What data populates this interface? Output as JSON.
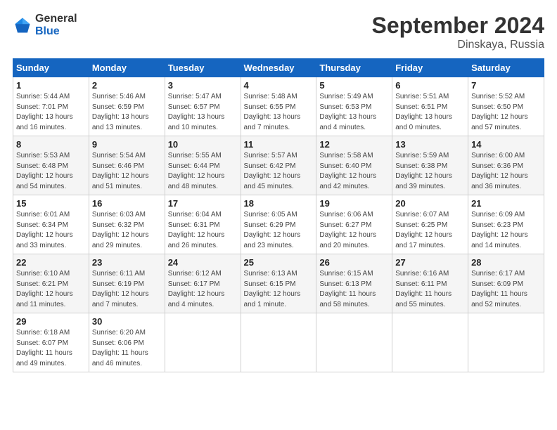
{
  "logo": {
    "general": "General",
    "blue": "Blue"
  },
  "title": "September 2024",
  "subtitle": "Dinskaya, Russia",
  "weekdays": [
    "Sunday",
    "Monday",
    "Tuesday",
    "Wednesday",
    "Thursday",
    "Friday",
    "Saturday"
  ],
  "weeks": [
    [
      {
        "day": "1",
        "detail": "Sunrise: 5:44 AM\nSunset: 7:01 PM\nDaylight: 13 hours\nand 16 minutes."
      },
      {
        "day": "2",
        "detail": "Sunrise: 5:46 AM\nSunset: 6:59 PM\nDaylight: 13 hours\nand 13 minutes."
      },
      {
        "day": "3",
        "detail": "Sunrise: 5:47 AM\nSunset: 6:57 PM\nDaylight: 13 hours\nand 10 minutes."
      },
      {
        "day": "4",
        "detail": "Sunrise: 5:48 AM\nSunset: 6:55 PM\nDaylight: 13 hours\nand 7 minutes."
      },
      {
        "day": "5",
        "detail": "Sunrise: 5:49 AM\nSunset: 6:53 PM\nDaylight: 13 hours\nand 4 minutes."
      },
      {
        "day": "6",
        "detail": "Sunrise: 5:51 AM\nSunset: 6:51 PM\nDaylight: 13 hours\nand 0 minutes."
      },
      {
        "day": "7",
        "detail": "Sunrise: 5:52 AM\nSunset: 6:50 PM\nDaylight: 12 hours\nand 57 minutes."
      }
    ],
    [
      {
        "day": "8",
        "detail": "Sunrise: 5:53 AM\nSunset: 6:48 PM\nDaylight: 12 hours\nand 54 minutes."
      },
      {
        "day": "9",
        "detail": "Sunrise: 5:54 AM\nSunset: 6:46 PM\nDaylight: 12 hours\nand 51 minutes."
      },
      {
        "day": "10",
        "detail": "Sunrise: 5:55 AM\nSunset: 6:44 PM\nDaylight: 12 hours\nand 48 minutes."
      },
      {
        "day": "11",
        "detail": "Sunrise: 5:57 AM\nSunset: 6:42 PM\nDaylight: 12 hours\nand 45 minutes."
      },
      {
        "day": "12",
        "detail": "Sunrise: 5:58 AM\nSunset: 6:40 PM\nDaylight: 12 hours\nand 42 minutes."
      },
      {
        "day": "13",
        "detail": "Sunrise: 5:59 AM\nSunset: 6:38 PM\nDaylight: 12 hours\nand 39 minutes."
      },
      {
        "day": "14",
        "detail": "Sunrise: 6:00 AM\nSunset: 6:36 PM\nDaylight: 12 hours\nand 36 minutes."
      }
    ],
    [
      {
        "day": "15",
        "detail": "Sunrise: 6:01 AM\nSunset: 6:34 PM\nDaylight: 12 hours\nand 33 minutes."
      },
      {
        "day": "16",
        "detail": "Sunrise: 6:03 AM\nSunset: 6:32 PM\nDaylight: 12 hours\nand 29 minutes."
      },
      {
        "day": "17",
        "detail": "Sunrise: 6:04 AM\nSunset: 6:31 PM\nDaylight: 12 hours\nand 26 minutes."
      },
      {
        "day": "18",
        "detail": "Sunrise: 6:05 AM\nSunset: 6:29 PM\nDaylight: 12 hours\nand 23 minutes."
      },
      {
        "day": "19",
        "detail": "Sunrise: 6:06 AM\nSunset: 6:27 PM\nDaylight: 12 hours\nand 20 minutes."
      },
      {
        "day": "20",
        "detail": "Sunrise: 6:07 AM\nSunset: 6:25 PM\nDaylight: 12 hours\nand 17 minutes."
      },
      {
        "day": "21",
        "detail": "Sunrise: 6:09 AM\nSunset: 6:23 PM\nDaylight: 12 hours\nand 14 minutes."
      }
    ],
    [
      {
        "day": "22",
        "detail": "Sunrise: 6:10 AM\nSunset: 6:21 PM\nDaylight: 12 hours\nand 11 minutes."
      },
      {
        "day": "23",
        "detail": "Sunrise: 6:11 AM\nSunset: 6:19 PM\nDaylight: 12 hours\nand 7 minutes."
      },
      {
        "day": "24",
        "detail": "Sunrise: 6:12 AM\nSunset: 6:17 PM\nDaylight: 12 hours\nand 4 minutes."
      },
      {
        "day": "25",
        "detail": "Sunrise: 6:13 AM\nSunset: 6:15 PM\nDaylight: 12 hours\nand 1 minute."
      },
      {
        "day": "26",
        "detail": "Sunrise: 6:15 AM\nSunset: 6:13 PM\nDaylight: 11 hours\nand 58 minutes."
      },
      {
        "day": "27",
        "detail": "Sunrise: 6:16 AM\nSunset: 6:11 PM\nDaylight: 11 hours\nand 55 minutes."
      },
      {
        "day": "28",
        "detail": "Sunrise: 6:17 AM\nSunset: 6:09 PM\nDaylight: 11 hours\nand 52 minutes."
      }
    ],
    [
      {
        "day": "29",
        "detail": "Sunrise: 6:18 AM\nSunset: 6:07 PM\nDaylight: 11 hours\nand 49 minutes."
      },
      {
        "day": "30",
        "detail": "Sunrise: 6:20 AM\nSunset: 6:06 PM\nDaylight: 11 hours\nand 46 minutes."
      },
      {
        "day": "",
        "detail": ""
      },
      {
        "day": "",
        "detail": ""
      },
      {
        "day": "",
        "detail": ""
      },
      {
        "day": "",
        "detail": ""
      },
      {
        "day": "",
        "detail": ""
      }
    ]
  ]
}
